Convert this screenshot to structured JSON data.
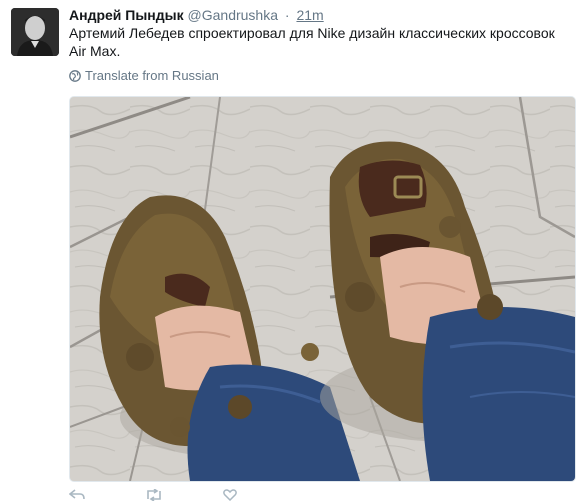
{
  "tweet": {
    "author_name": "Андрей Пындык",
    "author_handle": "@Gandrushka",
    "separator": "·",
    "time": "21m",
    "text": "Артемий Лебедев спроектировал для Nike дизайн классических кроссовок Air Max.",
    "translate_label": "Translate from Russian"
  },
  "icons": {
    "avatar": "avatar-photo",
    "translate": "globe-icon",
    "reply": "reply-icon",
    "retweet": "retweet-icon",
    "like": "heart-icon"
  },
  "colors": {
    "name": "#14171a",
    "meta": "#657786",
    "action": "#aab8c2"
  }
}
